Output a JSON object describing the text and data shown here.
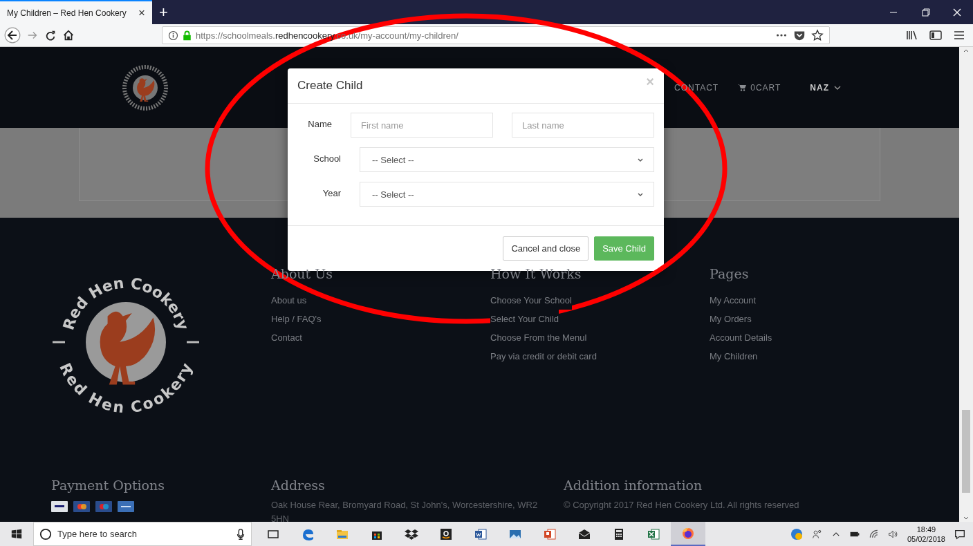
{
  "browser": {
    "tab_title": "My Children – Red Hen Cookery",
    "tab_close": "×",
    "new_tab": "+",
    "url_host_pre": "https://schoolmeals.",
    "url_host": "redhencookery",
    "url_rest": ".co.uk/my-account/my-children/"
  },
  "site_nav": [
    {
      "label": "CONTACT",
      "kind": "link"
    },
    {
      "label": "0CART",
      "kind": "cart"
    },
    {
      "label": "NAZ",
      "kind": "account"
    }
  ],
  "modal": {
    "title": "Create Child",
    "close": "×",
    "fields": [
      {
        "label": "Name",
        "kind": "text",
        "placeholders": [
          "First name",
          "Last name"
        ]
      },
      {
        "label": "School",
        "kind": "select",
        "value": "-- Select --"
      },
      {
        "label": "Year",
        "kind": "select",
        "value": "-- Select --"
      }
    ],
    "buttons": [
      {
        "label": "Cancel and close",
        "kind": "default"
      },
      {
        "label": "Save Child",
        "kind": "primary"
      }
    ]
  },
  "footer": {
    "logo": {
      "text_top": "Red Hen Cookery",
      "text_bottom": "Red Hen Cookery"
    },
    "columns": [
      {
        "heading": "About Us",
        "links": [
          "About us",
          "Help / FAQ's",
          "Contact"
        ]
      },
      {
        "heading": "How It Works",
        "links": [
          "Choose Your School",
          "Select Your Child",
          "Choose From the Menul",
          "Pay via credit or debit card"
        ]
      },
      {
        "heading": "Pages",
        "links": [
          "My Account",
          "My Orders",
          "Account Details",
          "My Children"
        ]
      }
    ],
    "payment": {
      "heading": "Payment Options",
      "cards": [
        {
          "kind": "visa"
        },
        {
          "kind": "mastercard"
        },
        {
          "kind": "maestro"
        },
        {
          "kind": "stripe"
        }
      ]
    },
    "address": {
      "heading": "Address",
      "lines": [
        "Oak House Rear, Bromyard Road, St John's, Worcestershire, WR2",
        "5HN"
      ]
    },
    "info": {
      "heading": "Addition information",
      "text": "© Copyright 2017 Red Hen Cookery Ltd. All rights reserved"
    }
  },
  "taskbar": {
    "search_placeholder": "Type here to search",
    "apps": [
      {
        "kind": "taskview",
        "active": false
      },
      {
        "kind": "edge",
        "active": false
      },
      {
        "kind": "explorer",
        "active": false
      },
      {
        "kind": "store",
        "active": false
      },
      {
        "kind": "dropbox",
        "active": false
      },
      {
        "kind": "amazon",
        "active": false
      },
      {
        "kind": "word",
        "active": false
      },
      {
        "kind": "photos",
        "active": false
      },
      {
        "kind": "powerpoint",
        "active": false
      },
      {
        "kind": "mail",
        "active": false
      },
      {
        "kind": "calculator",
        "active": false
      },
      {
        "kind": "excel",
        "active": false
      },
      {
        "kind": "firefox",
        "active": true
      }
    ],
    "time": "18:49",
    "date": "05/02/2018"
  }
}
